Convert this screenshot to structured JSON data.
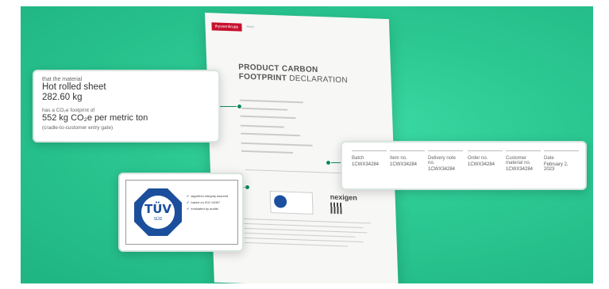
{
  "document": {
    "brand": "thyssenkrupp",
    "brand_small": "Steel",
    "title_bold": "PRODUCT CARBON",
    "title_bold_2": "FOOTPRINT",
    "title_light": "DECLARATION",
    "nexigen": "nexigen"
  },
  "callout_material": {
    "label_1": "that the material",
    "material": "Hot rolled sheet",
    "weight": "282.60 kg",
    "label_2": "has a CO₂e footprint of",
    "footprint": "552 kg CO₂e per metric ton",
    "scope": "(cradle-to-customer entry gate)"
  },
  "callout_table": {
    "columns": [
      {
        "label": "Batch",
        "value": "1CWX34284"
      },
      {
        "label": "Item no.",
        "value": "1CWX34284"
      },
      {
        "label": "Delivery note no.",
        "value": "1CWX34284"
      },
      {
        "label": "Order no.",
        "value": "1CWX34284"
      },
      {
        "label": "Customer material no.",
        "value": "1CWX34284"
      },
      {
        "label": "Date",
        "value": "February 2, 2023"
      }
    ]
  },
  "callout_cert": {
    "tuv_text": "TÜV",
    "tuv_sub": "SÜD",
    "checks": [
      "algorithm integrity assured",
      "based on ISO 14067",
      "evaluated by audits"
    ]
  },
  "colors": {
    "background": "#2cc993",
    "accent": "#0a8a5a",
    "brand": "#c8102e",
    "tuv_blue": "#1b4f9c"
  }
}
